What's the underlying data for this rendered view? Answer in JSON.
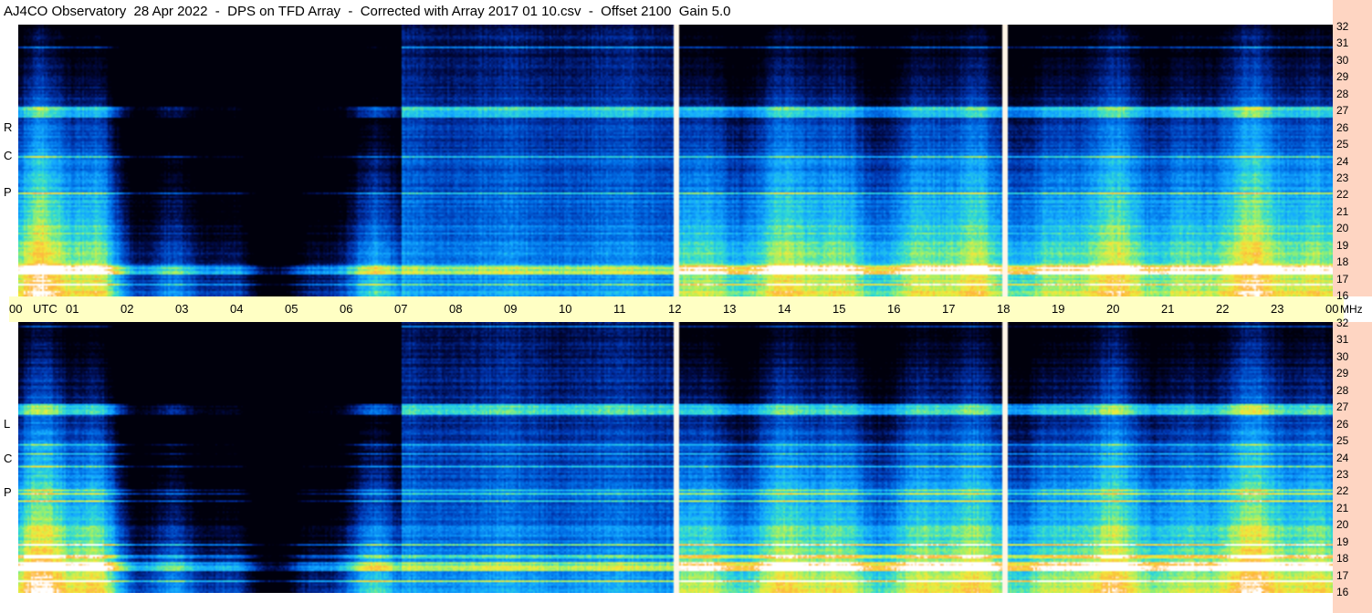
{
  "title": "AJ4CO Observatory  28 Apr 2022  -  DPS on TFD Array  -  Corrected with Array 2017 01 10.csv  -  Offset 2100  Gain 5.0",
  "top_panel_label": [
    "R",
    "C",
    "P"
  ],
  "bottom_panel_label": [
    "L",
    "C",
    "P"
  ],
  "chart_data": {
    "type": "heatmap",
    "title": "AJ4CO Observatory  28 Apr 2022  -  DPS on TFD Array  -  Corrected with Array 2017 01 10.csv  -  Offset 2100  Gain 5.0",
    "x_axis": {
      "unit": "UTC",
      "ticks": [
        "00",
        "01",
        "02",
        "03",
        "04",
        "05",
        "06",
        "07",
        "08",
        "09",
        "10",
        "11",
        "12",
        "13",
        "14",
        "15",
        "16",
        "17",
        "18",
        "19",
        "20",
        "21",
        "22",
        "23",
        "00"
      ],
      "range": [
        0,
        24
      ]
    },
    "y_axis": {
      "unit": "MHz",
      "ticks": [
        "32",
        "31",
        "30",
        "29",
        "28",
        "27",
        "26",
        "25",
        "24",
        "23",
        "22",
        "21",
        "20",
        "19",
        "18",
        "17",
        "16"
      ],
      "range": [
        16,
        32
      ]
    },
    "panels": [
      "RCP",
      "LCP"
    ],
    "colormap": [
      "#000010",
      "#001a80",
      "#0050e0",
      "#10a0ff",
      "#30e0d0",
      "#b0f060",
      "#ffd840",
      "#ff4090",
      "#ffffff"
    ]
  },
  "time_axis_labels": [
    "00",
    "01",
    "02",
    "03",
    "04",
    "05",
    "06",
    "07",
    "08",
    "09",
    "10",
    "11",
    "12",
    "13",
    "14",
    "15",
    "16",
    "17",
    "18",
    "19",
    "20",
    "21",
    "22",
    "23",
    "00"
  ],
  "utc_label": "UTC",
  "mhz_label": "MHz",
  "freq_labels": [
    "32",
    "31",
    "30",
    "29",
    "28",
    "27",
    "26",
    "25",
    "24",
    "23",
    "22",
    "21",
    "20",
    "19",
    "18",
    "17",
    "16"
  ]
}
